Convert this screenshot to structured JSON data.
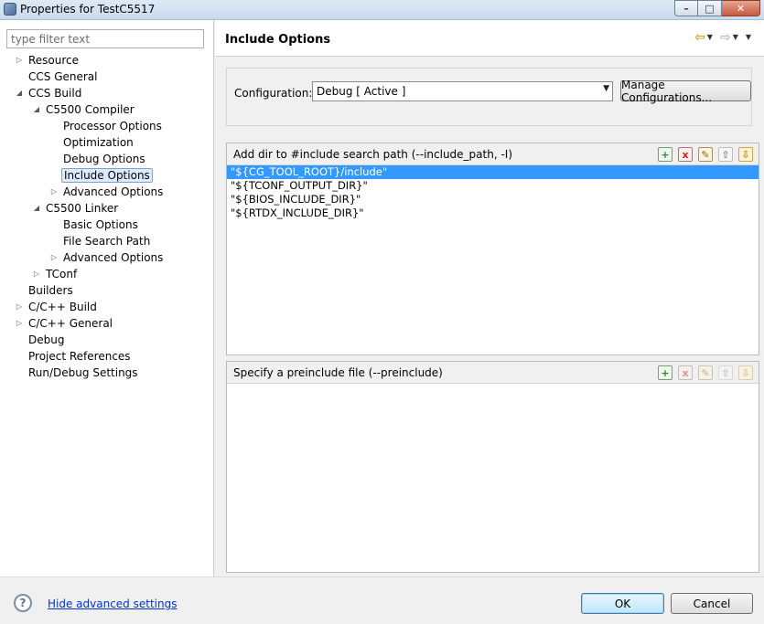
{
  "window": {
    "title": "Properties for TestC5517",
    "minimize_glyph": "–",
    "maximize_glyph": "□",
    "close_glyph": "✕"
  },
  "filter": {
    "placeholder": "type filter text",
    "value": ""
  },
  "tree": [
    {
      "label": "Resource",
      "level": 1,
      "twisty": "collapsed"
    },
    {
      "label": "CCS General",
      "level": 1,
      "twisty": "none"
    },
    {
      "label": "CCS Build",
      "level": 1,
      "twisty": "expanded"
    },
    {
      "label": "C5500 Compiler",
      "level": 2,
      "twisty": "expanded"
    },
    {
      "label": "Processor Options",
      "level": 3,
      "twisty": "none"
    },
    {
      "label": "Optimization",
      "level": 3,
      "twisty": "none"
    },
    {
      "label": "Debug Options",
      "level": 3,
      "twisty": "none"
    },
    {
      "label": "Include Options",
      "level": 3,
      "twisty": "none",
      "selected": true
    },
    {
      "label": "Advanced Options",
      "level": 3,
      "twisty": "collapsed"
    },
    {
      "label": "C5500 Linker",
      "level": 2,
      "twisty": "expanded"
    },
    {
      "label": "Basic Options",
      "level": 3,
      "twisty": "none"
    },
    {
      "label": "File Search Path",
      "level": 3,
      "twisty": "none"
    },
    {
      "label": "Advanced Options",
      "level": 3,
      "twisty": "collapsed"
    },
    {
      "label": "TConf",
      "level": 2,
      "twisty": "collapsed"
    },
    {
      "label": "Builders",
      "level": 1,
      "twisty": "none"
    },
    {
      "label": "C/C++ Build",
      "level": 1,
      "twisty": "collapsed"
    },
    {
      "label": "C/C++ General",
      "level": 1,
      "twisty": "collapsed"
    },
    {
      "label": "Debug",
      "level": 1,
      "twisty": "none"
    },
    {
      "label": "Project References",
      "level": 1,
      "twisty": "none"
    },
    {
      "label": "Run/Debug Settings",
      "level": 1,
      "twisty": "none"
    }
  ],
  "page": {
    "title": "Include Options",
    "nav": {
      "back_icon": "back-arrow-icon",
      "forward_icon": "forward-arrow-icon"
    }
  },
  "configuration": {
    "label": "Configuration:",
    "selected": "Debug  [ Active ]",
    "manage_label": "Manage Configurations..."
  },
  "include_paths": {
    "title": "Add dir to #include search path (--include_path, -I)",
    "items": [
      "\"${CG_TOOL_ROOT}/include\"",
      "\"${TCONF_OUTPUT_DIR}\"",
      "\"${BIOS_INCLUDE_DIR}\"",
      "\"${RTDX_INCLUDE_DIR}\""
    ],
    "selected_index": 0
  },
  "preinclude": {
    "title": "Specify a preinclude file (--preinclude)",
    "items": []
  },
  "toolbar_glyphs": {
    "add": "+",
    "delete": "x",
    "edit": "✎",
    "up": "⇧",
    "down": "⇩"
  },
  "footer": {
    "help_glyph": "?",
    "advanced_link": "Hide advanced settings",
    "ok_label": "OK",
    "cancel_label": "Cancel"
  },
  "colors": {
    "selection": "#3399ff",
    "tree_selection": "#dcebfc",
    "link": "#0033cc"
  }
}
